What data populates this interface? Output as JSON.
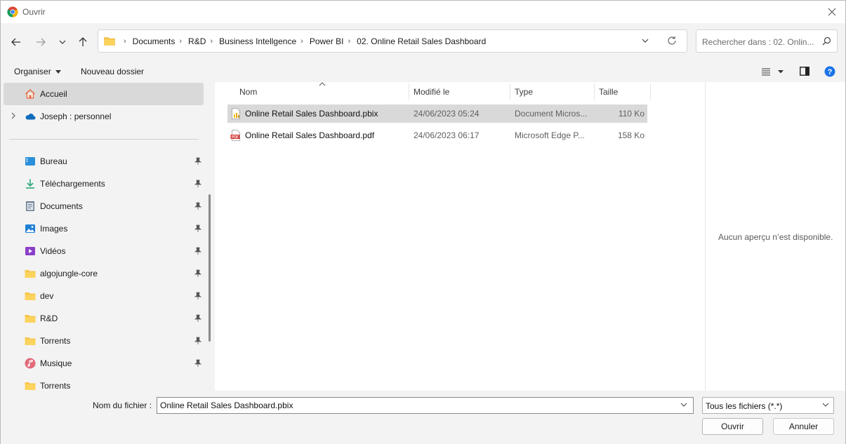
{
  "window": {
    "title": "Ouvrir"
  },
  "address": {
    "breadcrumbs": [
      "Documents",
      "R&D",
      "Business Intellgence",
      "Power BI",
      "02. Online Retail Sales Dashboard"
    ]
  },
  "search": {
    "placeholder": "Rechercher dans : 02. Onlin..."
  },
  "toolbar": {
    "organize_label": "Organiser",
    "new_folder_label": "Nouveau dossier"
  },
  "sidebar": {
    "items": [
      {
        "label": "Accueil",
        "icon": "home-icon"
      },
      {
        "label": "Joseph : personnel",
        "icon": "onedrive-cloud-icon"
      },
      {
        "label": "Bureau",
        "icon": "desktop-icon"
      },
      {
        "label": "Téléchargements",
        "icon": "download-icon"
      },
      {
        "label": "Documents",
        "icon": "documents-icon"
      },
      {
        "label": "Images",
        "icon": "pictures-icon"
      },
      {
        "label": "Vidéos",
        "icon": "videos-icon"
      },
      {
        "label": "algojungle-core",
        "icon": "folder-icon"
      },
      {
        "label": "dev",
        "icon": "folder-icon"
      },
      {
        "label": "R&D",
        "icon": "folder-icon"
      },
      {
        "label": "Torrents",
        "icon": "folder-icon"
      },
      {
        "label": "Musique",
        "icon": "music-icon"
      },
      {
        "label": "Torrents",
        "icon": "folder-icon"
      }
    ]
  },
  "columns": {
    "name": "Nom",
    "modified": "Modifié le",
    "type": "Type",
    "size": "Taille"
  },
  "files": [
    {
      "name": "Online Retail Sales Dashboard.pbix",
      "modified": "24/06/2023 05:24",
      "type": "Document Micros...",
      "size": "110 Ko",
      "icon": "powerbi-file-icon",
      "selected": true
    },
    {
      "name": "Online Retail Sales Dashboard.pdf",
      "modified": "24/06/2023 06:17",
      "type": "Microsoft Edge P...",
      "size": "158 Ko",
      "icon": "pdf-file-icon",
      "selected": false
    }
  ],
  "preview": {
    "message": "Aucun aperçu n’est disponible."
  },
  "footer": {
    "filename_label": "Nom du fichier :",
    "filename_value": "Online Retail Sales Dashboard.pbix",
    "filetype_value": "Tous les fichiers (*.*)",
    "open_label": "Ouvrir",
    "cancel_label": "Annuler"
  }
}
